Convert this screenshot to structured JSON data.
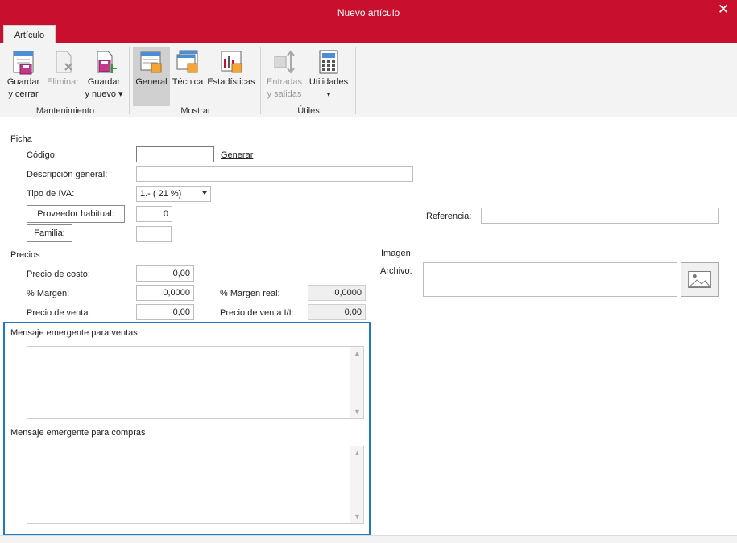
{
  "window": {
    "title": "Nuevo artículo",
    "close_glyph": "✕"
  },
  "tabs": {
    "active": "Artículo"
  },
  "ribbon": {
    "groups": {
      "mantenimiento": "Mantenimiento",
      "mostrar": "Mostrar",
      "utiles": "Útiles"
    },
    "buttons": {
      "guardar_cerrar": {
        "line1": "Guardar",
        "line2": "y cerrar"
      },
      "eliminar": {
        "line1": "Eliminar"
      },
      "guardar_nuevo": {
        "line1": "Guardar",
        "line2": "y nuevo ▾"
      },
      "general": {
        "line1": "General"
      },
      "tecnica": {
        "line1": "Técnica"
      },
      "estadisticas": {
        "line1": "Estadísticas"
      },
      "entradas": {
        "line1": "Entradas",
        "line2": "y salidas"
      },
      "utilidades": {
        "line1": "Utilidades",
        "line2": "▾"
      }
    }
  },
  "ficha": {
    "section": "Ficha",
    "codigo_label": "Código:",
    "codigo_value": "",
    "generar_link": "Generar",
    "descripcion_label": "Descripción general:",
    "descripcion_value": "",
    "iva_label": "Tipo de IVA:",
    "iva_value": "1.- ( 21 %)",
    "proveedor_button": "Proveedor habitual:",
    "proveedor_value": "0",
    "familia_button": "Familia:",
    "familia_value": "",
    "referencia_label": "Referencia:",
    "referencia_value": ""
  },
  "precios": {
    "section": "Precios",
    "costo_label": "Precio de costo:",
    "costo_value": "0,00",
    "margen_label": "% Margen:",
    "margen_value": "0,0000",
    "margen_real_label": "% Margen real:",
    "margen_real_value": "0,0000",
    "venta_label": "Precio de venta:",
    "venta_value": "0,00",
    "venta_ii_label": "Precio de venta I/I:",
    "venta_ii_value": "0,00"
  },
  "imagen": {
    "section": "Imagen",
    "archivo_label": "Archivo:",
    "archivo_value": ""
  },
  "mensajes": {
    "ventas_label": "Mensaje emergente para ventas",
    "compras_label": "Mensaje emergente para compras"
  },
  "icons": {
    "close": "close-icon",
    "save_close": "save-close-icon",
    "delete": "delete-icon",
    "save_new": "save-new-icon",
    "general": "general-view-icon",
    "tecnica": "technical-view-icon",
    "estadisticas": "statistics-icon",
    "entradas": "stock-movements-icon",
    "utilidades": "calculator-icon",
    "image": "image-placeholder-icon"
  },
  "colors": {
    "brand": "#c8102e",
    "focus_frame": "#1f7ac2"
  }
}
